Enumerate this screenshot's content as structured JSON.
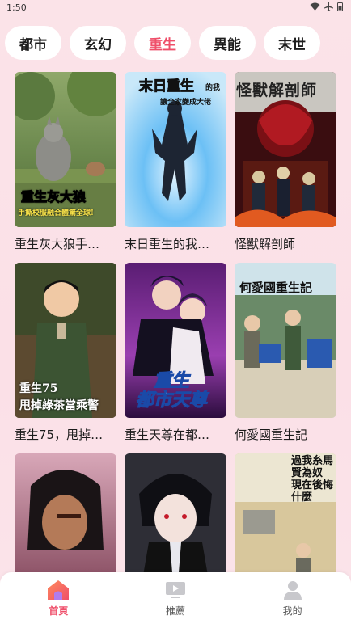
{
  "status_bar": {
    "time": "1:50",
    "icons": [
      "wifi-icon",
      "airplane-icon",
      "battery-icon"
    ]
  },
  "tabs": [
    {
      "label": "都市",
      "active": false
    },
    {
      "label": "玄幻",
      "active": false
    },
    {
      "label": "重生",
      "active": true
    },
    {
      "label": "異能",
      "active": false
    },
    {
      "label": "末世",
      "active": false
    }
  ],
  "accent_color": "#ef4f6a",
  "cards": [
    {
      "title": "重生灰大狼手…",
      "cover_text_main": "重生灰大狼",
      "cover_text_sub": "手撕校服融合體驚全球!"
    },
    {
      "title": "末日重生的我…",
      "cover_text_main": "末日重生",
      "cover_text_sub": "的我",
      "cover_text_sub2": "讓全家變成大佬"
    },
    {
      "title": "怪獸解剖師",
      "cover_text_main": "怪獸解剖師"
    },
    {
      "title": "重生75，甩掉…",
      "cover_text_main": "重生75",
      "cover_text_sub": "甩掉綠茶當乘警"
    },
    {
      "title": "重生天尊在都…",
      "cover_text_main": "重生",
      "cover_text_sub": "都市天尊"
    },
    {
      "title": "何愛國重生記",
      "cover_text_main": "何愛國重生記"
    },
    {
      "title": "",
      "cover_text_main": ""
    },
    {
      "title": "",
      "cover_text_main": ""
    },
    {
      "title": "",
      "cover_text_main": "過我糸馬賢為奴 現在後悔什麼"
    }
  ],
  "bottom_nav": [
    {
      "label": "首頁",
      "icon": "home-icon",
      "active": true
    },
    {
      "label": "推薦",
      "icon": "tv-icon",
      "active": false
    },
    {
      "label": "我的",
      "icon": "person-icon",
      "active": false
    }
  ]
}
